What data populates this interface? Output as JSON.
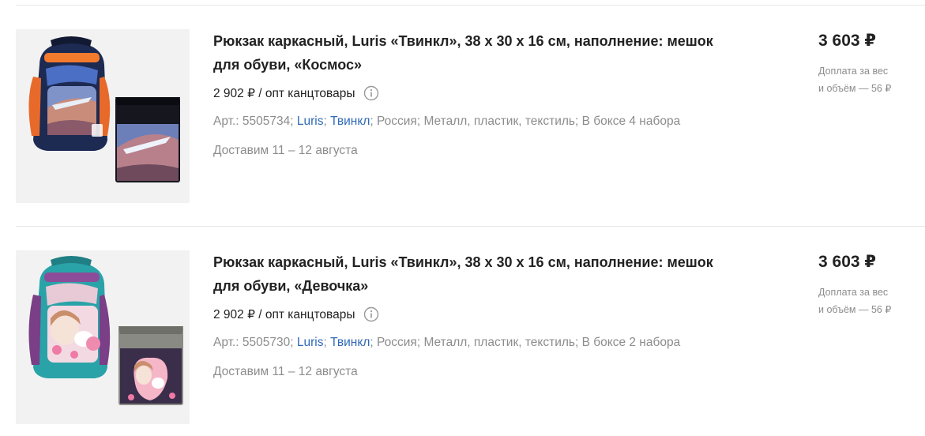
{
  "products": [
    {
      "title_line1": "Рюкзак каркасный, Luris «Твинкл», 38 х 30 х 16 см, наполнение: мешок",
      "title_line2": "для обуви, «Космос»",
      "unit_price": "2 902 ₽ / опт канцтовары",
      "article": "Арт.: 5505734;",
      "brand": "Luris",
      "series": "Твинкл",
      "country": "Россия;",
      "material": "Металл, пластик, текстиль;",
      "box": "В боксе 4 набора",
      "delivery": "Доставим 11 – 12 августа",
      "price": "3 603 ₽",
      "surcharge_line1": "Доплата за вес",
      "surcharge_line2": "и объём — 56 ₽",
      "image_subject": "backpack-space-theme"
    },
    {
      "title_line1": "Рюкзак каркасный, Luris «Твинкл», 38 х 30 х 16 см, наполнение: мешок",
      "title_line2": "для обуви, «Девочка»",
      "unit_price": "2 902 ₽ / опт канцтовары",
      "article": "Арт.: 5505730;",
      "brand": "Luris",
      "series": "Твинкл",
      "country": "Россия;",
      "material": "Металл, пластик, текстиль;",
      "box": "В боксе 2 набора",
      "delivery": "Доставим 11 – 12 августа",
      "price": "3 603 ₽",
      "surcharge_line1": "Доплата за вес",
      "surcharge_line2": "и объём — 56 ₽",
      "image_subject": "backpack-girl-kitten-theme"
    }
  ],
  "colors": {
    "text": "#222222",
    "muted": "#8c8c8c",
    "link": "#2f6ab9",
    "divider": "#e6e6e6",
    "image_bg": "#f2f2f2"
  },
  "icons": {
    "info": "info-circle-icon"
  }
}
